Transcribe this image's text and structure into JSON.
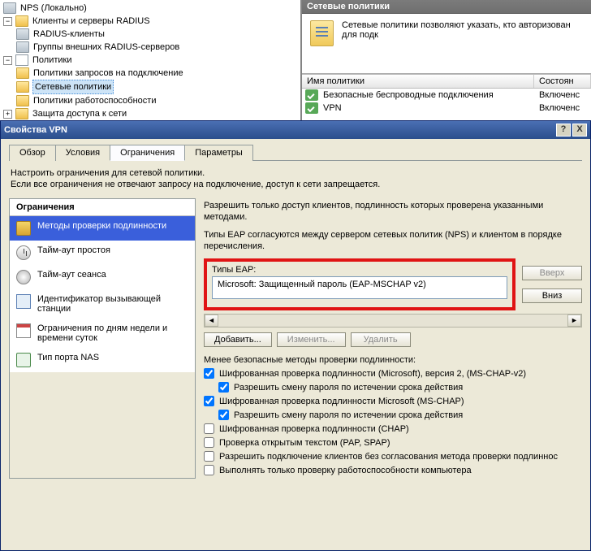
{
  "mmc": {
    "tree": {
      "root": "NPS (Локально)",
      "clients": "Клиенты и серверы RADIUS",
      "radius_clients": "RADIUS-клиенты",
      "ext_servers": "Группы внешних RADIUS-серверов",
      "policies": "Политики",
      "req_policies": "Политики запросов на подключение",
      "net_policies": "Сетевые политики",
      "health_policies": "Политики работоспособности",
      "net_access": "Защита доступа к сети"
    },
    "right": {
      "title": "Сетевые политики",
      "desc": "Сетевые политики позволяют указать, кто авторизован для подк",
      "col_name": "Имя политики",
      "col_state": "Состоян",
      "rows": [
        {
          "name": "Безопасные беспроводные подключения",
          "state": "Включенс"
        },
        {
          "name": "VPN",
          "state": "Включенс"
        }
      ]
    }
  },
  "dialog": {
    "title": "Свойства VPN",
    "close": "X",
    "help": "?",
    "tabs": {
      "overview": "Обзор",
      "conditions": "Условия",
      "constraints": "Ограничения",
      "params": "Параметры"
    },
    "intro_l1": "Настроить ограничения для сетевой политики.",
    "intro_l2": "Если все ограничения не отвечают запросу на подключение, доступ к сети запрещается.",
    "left": {
      "title": "Ограничения",
      "items": {
        "auth": "Методы проверки подлинности",
        "idle": "Тайм-аут простоя",
        "session": "Тайм-аут сеанса",
        "callerid": "Идентификатор вызывающей станции",
        "daytime": "Ограничения по дням недели и времени суток",
        "nas": "Тип порта NAS"
      }
    },
    "right": {
      "allow": "Разрешить только доступ клиентов, подлинность которых проверена указанными методами.",
      "eap_note": "Типы EAP согласуются между сервером сетевых политик (NPS) и клиентом в порядке перечисления.",
      "eap_label": "Типы EAP:",
      "eap_item": "Microsoft: Защищенный пароль (EAP-MSCHAP v2)",
      "btn_up": "Вверх",
      "btn_down": "Вниз",
      "btn_add": "Добавить...",
      "btn_edit": "Изменить...",
      "btn_del": "Удалить",
      "checks_title": "Менее безопасные методы проверки подлинности:",
      "c1": "Шифрованная проверка подлинности (Microsoft), версия 2, (MS-CHAP-v2)",
      "c1a": "Разрешить смену пароля по истечении срока действия",
      "c2": "Шифрованная проверка подлинности Microsoft (MS-CHAP)",
      "c2a": "Разрешить смену пароля по истечении срока действия",
      "c3": "Шифрованная проверка подлинности (CHAP)",
      "c4": "Проверка открытым текстом (PAP, SPAP)",
      "c5": "Разрешить подключение клиентов без согласования метода проверки подлиннос",
      "c6": "Выполнять только проверку работоспособности компьютера"
    }
  }
}
